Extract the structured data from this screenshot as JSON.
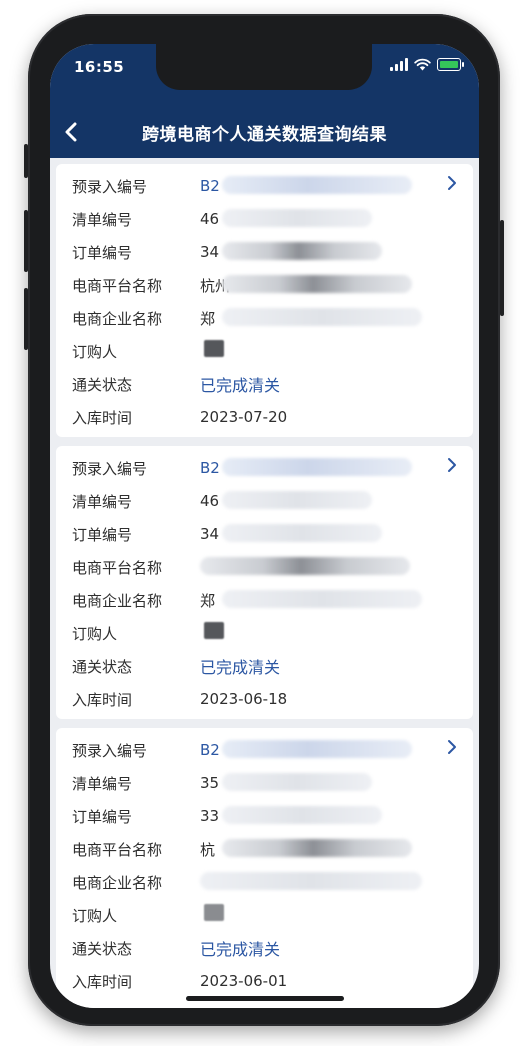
{
  "status_bar": {
    "time": "16:55"
  },
  "nav": {
    "title": "跨境电商个人通关数据查询结果"
  },
  "labels": {
    "record_no": "预录入编号",
    "list_no": "清单编号",
    "order_no": "订单编号",
    "platform": "电商平台名称",
    "company": "电商企业名称",
    "buyer": "订购人",
    "status": "通关状态",
    "storage_time": "入库时间"
  },
  "records": [
    {
      "record_no": "B2",
      "list_no": "46",
      "order_no": "34",
      "platform": "杭州",
      "company": "郑",
      "buyer": "",
      "status": "已完成清关",
      "storage_time": "2023-07-20"
    },
    {
      "record_no": "B2",
      "list_no": "46",
      "order_no": "34",
      "platform": "",
      "company": "郑",
      "buyer": "",
      "status": "已完成清关",
      "storage_time": "2023-06-18"
    },
    {
      "record_no": "B2",
      "list_no": "35",
      "order_no": "33",
      "platform": "杭",
      "company": "",
      "buyer": "",
      "status": "已完成清关",
      "storage_time": "2023-06-01"
    }
  ],
  "colors": {
    "header_bg": "#143566",
    "link_blue": "#2c57a3",
    "page_bg": "#eceef2"
  }
}
